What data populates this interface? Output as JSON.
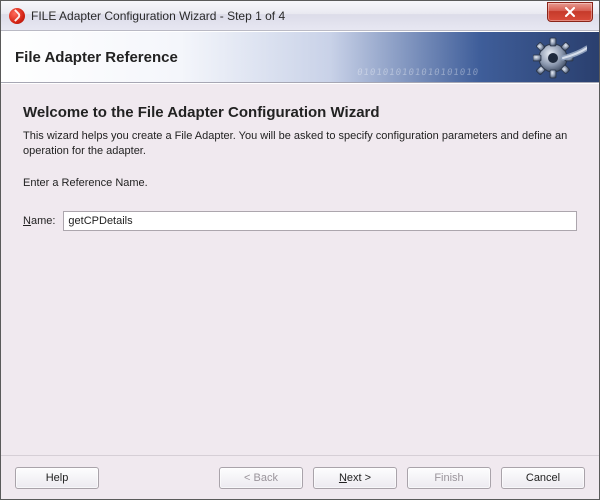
{
  "window": {
    "title": "FILE Adapter Configuration Wizard - Step 1 of 4"
  },
  "banner": {
    "title": "File Adapter Reference",
    "decoration_digits": "0101010101010101010"
  },
  "content": {
    "welcome_title": "Welcome to the File Adapter Configuration Wizard",
    "description": "This wizard helps you create a File Adapter. You will be asked to specify configuration parameters and define an operation for the adapter.",
    "prompt": "Enter a Reference Name.",
    "name_label_prefix": "N",
    "name_label_rest": "ame:",
    "name_value": "getCPDetails"
  },
  "buttons": {
    "help": "Help",
    "back": "< Back",
    "next_prefix": "N",
    "next_rest": "ext >",
    "finish": "Finish",
    "cancel": "Cancel"
  }
}
